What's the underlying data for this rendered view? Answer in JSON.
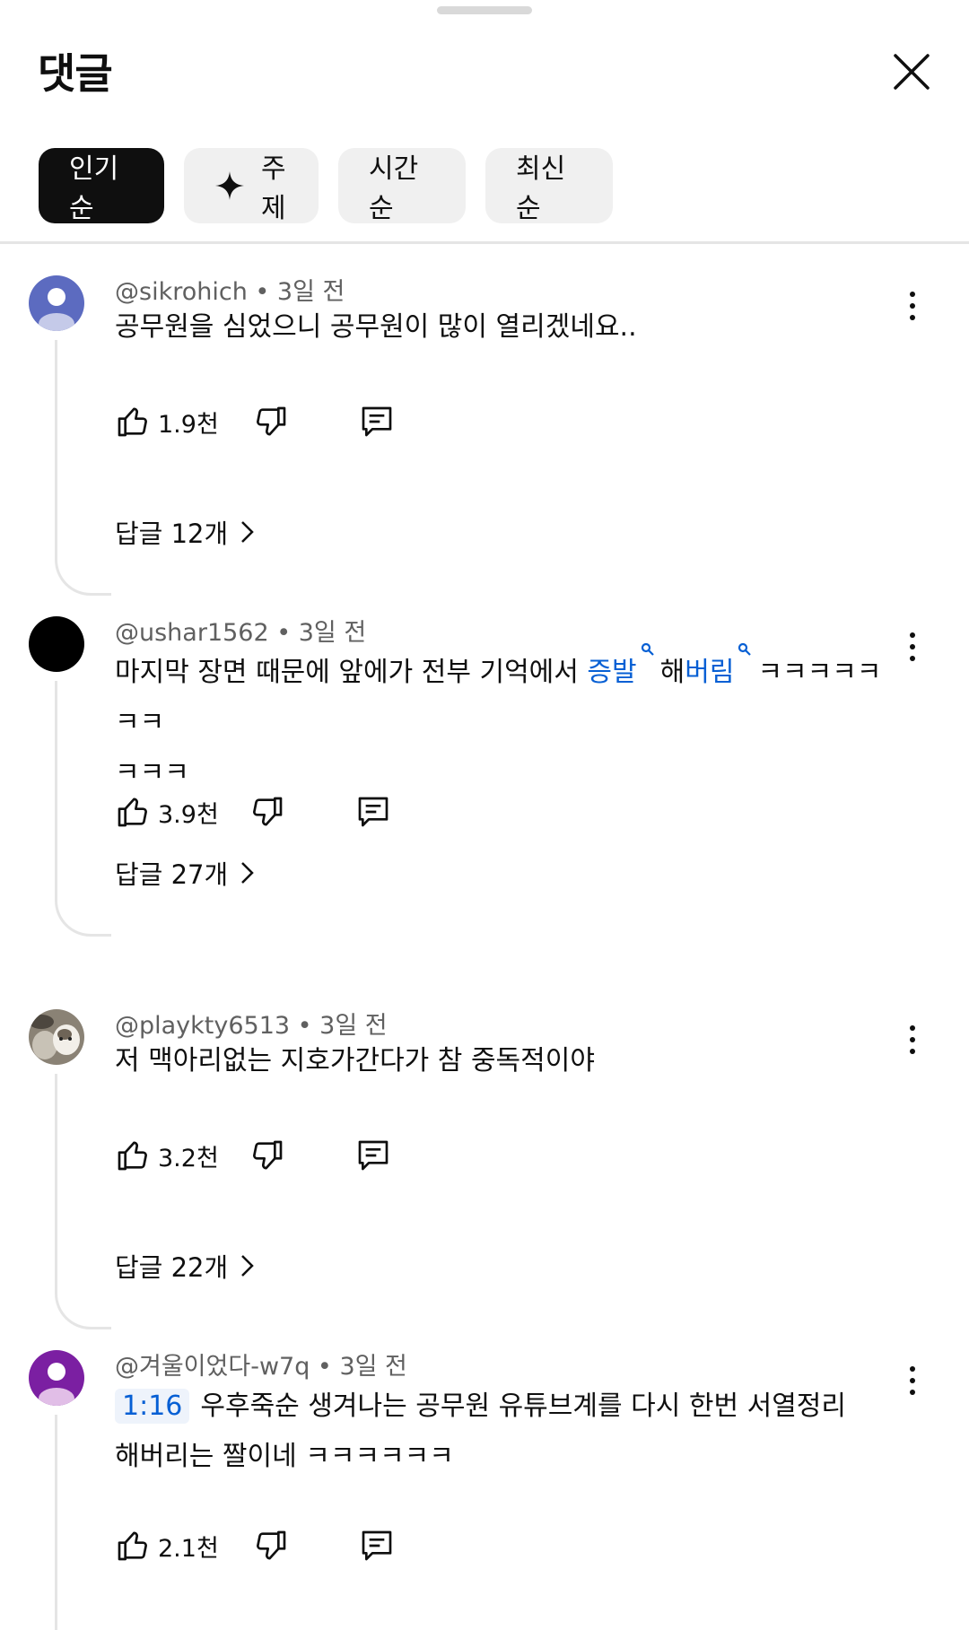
{
  "header": {
    "title": "댓글"
  },
  "sort_chips": [
    {
      "label": "인기순",
      "active": true
    },
    {
      "label": "주제",
      "icon": "sparkle-icon"
    },
    {
      "label": "시간순"
    },
    {
      "label": "최신순"
    }
  ],
  "comments": [
    {
      "author": "@sikrohich",
      "time": "3일 전",
      "text": "공무원을 심었으니 공무원이 많이 열리겠네요..",
      "likes": "1.9천",
      "replies": "답글 12개",
      "avatar_color": "#5c6bc0"
    },
    {
      "author": "@ushar1562",
      "time": "3일 전",
      "text_before": "마지막 장면 때문에 앞에가 전부 기억에서 ",
      "link1": "증발",
      "text_mid": "해",
      "link2": "버림",
      "text_after": "ㅋㅋㅋㅋㅋㅋㅋ",
      "text_line2": "ㅋㅋㅋ",
      "likes": "3.9천",
      "replies": "답글 27개",
      "avatar_color": "#000000"
    },
    {
      "author": "@playkty6513",
      "time": "3일 전",
      "text": "저 맥아리없는 지호가간다가 참 중독적이야",
      "likes": "3.2천",
      "replies": "답글 22개"
    },
    {
      "author": "@겨울이었다-w7q",
      "time": "3일 전",
      "timestamp": "1:16",
      "text_line1": "우후죽순 생겨나는 공무원 유튜브계를 다시 한번 서열정리",
      "text_line2": "해버리는 짤이네 ㅋㅋㅋㅋㅋㅋ",
      "likes": "2.1천",
      "avatar_color": "#7b1fa2"
    }
  ],
  "icons": {
    "like": "thumbs-up-icon",
    "dislike": "thumbs-down-icon",
    "reply": "comment-icon",
    "more": "more-vert-icon",
    "close": "close-icon",
    "search_hint": "search-icon",
    "chevron": "chevron-right-icon"
  },
  "colors": {
    "link": "#065fd4",
    "chip_active": "#0f0f0f",
    "chip_bg": "#f0f0f0"
  }
}
